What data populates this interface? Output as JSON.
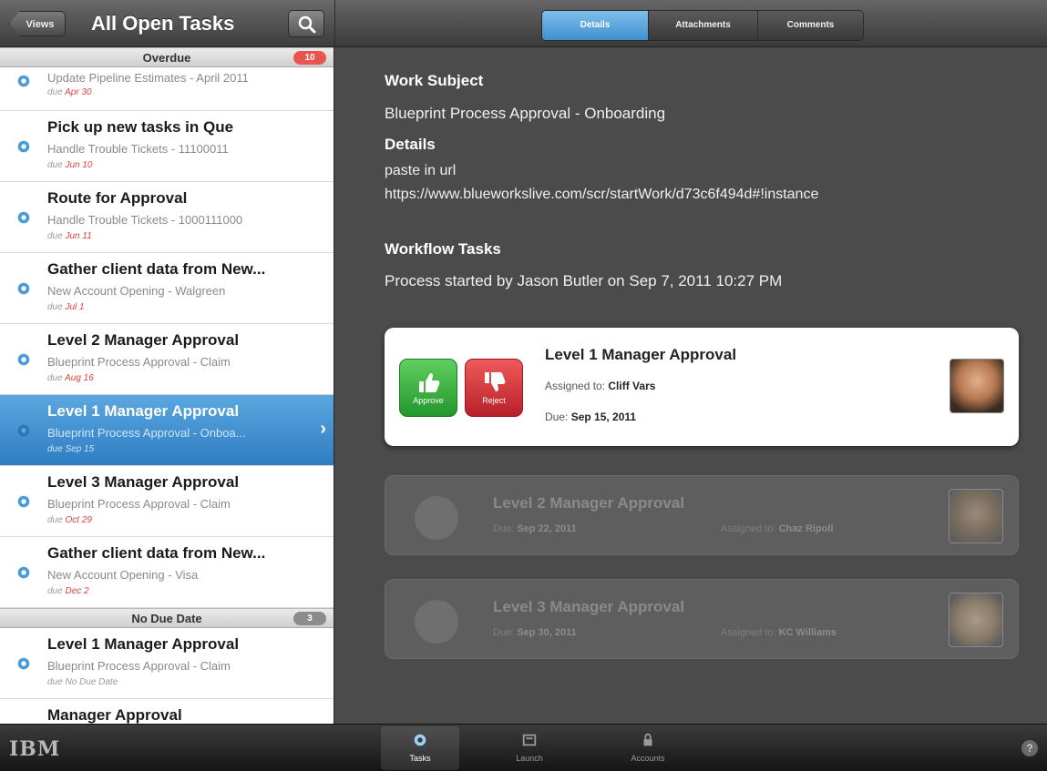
{
  "header": {
    "views_label": "Views",
    "title": "All Open Tasks"
  },
  "tabs": [
    {
      "label": "Details",
      "active": true
    },
    {
      "label": "Attachments",
      "active": false
    },
    {
      "label": "Comments",
      "active": false
    }
  ],
  "list": {
    "overdue": {
      "label": "Overdue",
      "count": "10",
      "items": [
        {
          "title": "",
          "subtitle": "Update Pipeline Estimates - April 2011",
          "due_prefix": "due",
          "due": "Apr 30"
        },
        {
          "title": "Pick up new tasks in Que",
          "subtitle": "Handle Trouble Tickets - 11100011",
          "due_prefix": "due",
          "due": "Jun 10"
        },
        {
          "title": "Route for Approval",
          "subtitle": "Handle Trouble Tickets - 1000111000",
          "due_prefix": "due",
          "due": "Jun 11"
        },
        {
          "title": "Gather client data from New...",
          "subtitle": "New Account Opening - Walgreen",
          "due_prefix": "due",
          "due": "Jul 1"
        },
        {
          "title": "Level 2 Manager Approval",
          "subtitle": "Blueprint Process Approval - Claim",
          "due_prefix": "due",
          "due": "Aug 16"
        },
        {
          "title": "Level 1 Manager Approval",
          "subtitle": "Blueprint Process Approval - Onboa...",
          "due_prefix": "due",
          "due": "Sep 15"
        },
        {
          "title": "Level 3 Manager Approval",
          "subtitle": "Blueprint Process Approval - Claim",
          "due_prefix": "due",
          "due": "Oct 29"
        },
        {
          "title": "Gather client data from New...",
          "subtitle": "New Account Opening - Visa",
          "due_prefix": "due",
          "due": "Dec 2"
        }
      ]
    },
    "no_due": {
      "label": "No Due Date",
      "count": "3",
      "items": [
        {
          "title": "Level 1 Manager Approval",
          "subtitle": "Blueprint Process Approval - Claim",
          "due_prefix": "due",
          "due": "No Due Date"
        },
        {
          "title": "Manager Approval"
        }
      ]
    }
  },
  "detail": {
    "work_subject_heading": "Work Subject",
    "work_subject": "Blueprint Process Approval - Onboarding",
    "details_heading": "Details",
    "details_line1": "paste in url",
    "details_line2": "https://www.blueworkslive.com/scr/startWork/d73c6f494d#!instance",
    "workflow_heading": "Workflow Tasks",
    "workflow_text": "Process started by Jason Butler on Sep 7, 2011 10:27 PM",
    "active_task": {
      "title": "Level 1 Manager Approval",
      "assigned_label": "Assigned to:",
      "assigned_to": "Cliff Vars",
      "due_label": "Due:",
      "due": "Sep 15, 2011",
      "approve_label": "Approve",
      "reject_label": "Reject"
    },
    "pending_tasks": [
      {
        "title": "Level 2 Manager Approval",
        "due_label": "Due:",
        "due": "Sep 22, 2011",
        "assigned_label": "Assigned to:",
        "assigned_to": "Chaz Ripoll"
      },
      {
        "title": "Level 3 Manager Approval",
        "due_label": "Due:",
        "due": "Sep 30, 2011",
        "assigned_label": "Assigned to:",
        "assigned_to": "KC Williams"
      }
    ]
  },
  "tabbar": {
    "brand": "IBM",
    "items": [
      {
        "label": "Tasks",
        "icon": "gear-icon",
        "active": true
      },
      {
        "label": "Launch",
        "icon": "launch-icon",
        "active": false
      },
      {
        "label": "Accounts",
        "icon": "lock-icon",
        "active": false
      }
    ],
    "help_label": "?"
  },
  "colors": {
    "accent_blue": "#3f8fcf",
    "overdue_red": "#e0433e",
    "approve_green": "#23962d",
    "reject_red": "#b8202a"
  }
}
